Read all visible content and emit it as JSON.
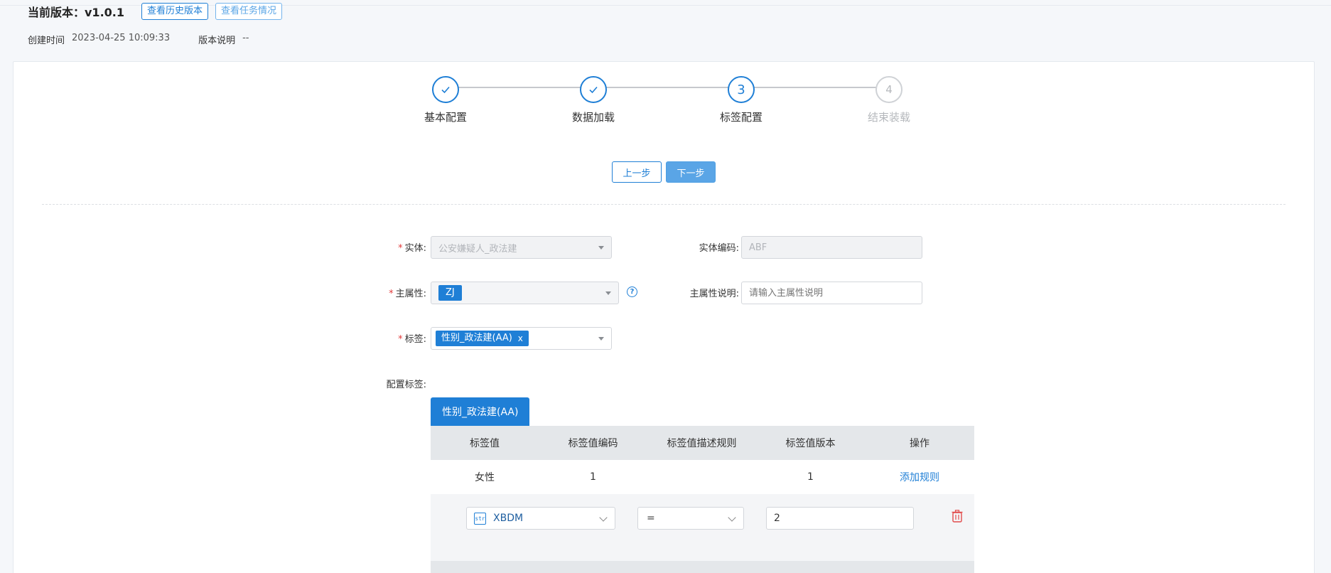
{
  "header": {
    "version_title": "当前版本：v1.0.1",
    "history_button": "查看历史版本",
    "tasks_button": "查看任务情况",
    "created_label": "创建时间",
    "created_value": "2023-04-25 10:09:33",
    "desc_label": "版本说明",
    "desc_value": "--"
  },
  "steps": [
    {
      "label": "基本配置",
      "status": "done",
      "icon": "check-icon"
    },
    {
      "label": "数据加载",
      "status": "done",
      "icon": "check-icon"
    },
    {
      "label": "标签配置",
      "status": "active",
      "number": "3"
    },
    {
      "label": "结束装载",
      "status": "pending",
      "number": "4"
    }
  ],
  "nav": {
    "prev": "上一步",
    "next": "下一步"
  },
  "form": {
    "entity_label": "实体:",
    "entity_value": "公安嫌疑人_政法建",
    "entity_code_label": "实体编码:",
    "entity_code_value": "ABF",
    "main_attr_label": "主属性:",
    "main_attr_chip": "ZJ",
    "main_attr_desc_label": "主属性说明:",
    "main_attr_desc_placeholder": "请输入主属性说明",
    "tag_label": "标签:",
    "tag_chip": "性别_政法建(AA)",
    "tag_chip_close": "x",
    "config_tag_label": "配置标签:"
  },
  "tabs": [
    {
      "label": "性别_政法建(AA)",
      "active": true
    }
  ],
  "table": {
    "columns": [
      "标签值",
      "标签值编码",
      "标签值描述规则",
      "标签值版本",
      "操作"
    ],
    "rows": [
      {
        "value": "女性",
        "code": "1",
        "rule": "",
        "version": "1",
        "action": "添加规则"
      }
    ]
  },
  "rule": {
    "field_type": "str",
    "field": "XBDM",
    "operator": "=",
    "value": "2"
  },
  "colors": {
    "accent": "#1f7fd6",
    "danger": "#e23b3b"
  }
}
